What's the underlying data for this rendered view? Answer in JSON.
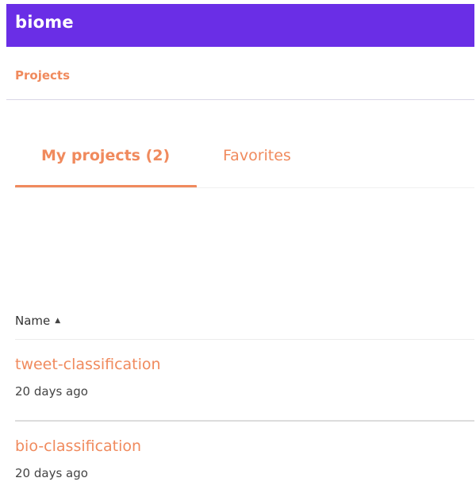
{
  "app": {
    "brand": "biome"
  },
  "breadcrumb": {
    "label": "Projects"
  },
  "tabs": [
    {
      "label": "My projects (2)",
      "active": true
    },
    {
      "label": "Favorites",
      "active": false
    }
  ],
  "table": {
    "sort_column": "Name",
    "sort_direction_icon": "sort-ascending-icon",
    "rows": [
      {
        "name": "tweet-classification",
        "updated": "20 days ago"
      },
      {
        "name": "bio-classification",
        "updated": "20 days ago"
      }
    ]
  },
  "colors": {
    "brand_bar": "#6a2ee6",
    "accent": "#f08a5d",
    "text": "#444444",
    "divider": "#dcdcdc"
  }
}
